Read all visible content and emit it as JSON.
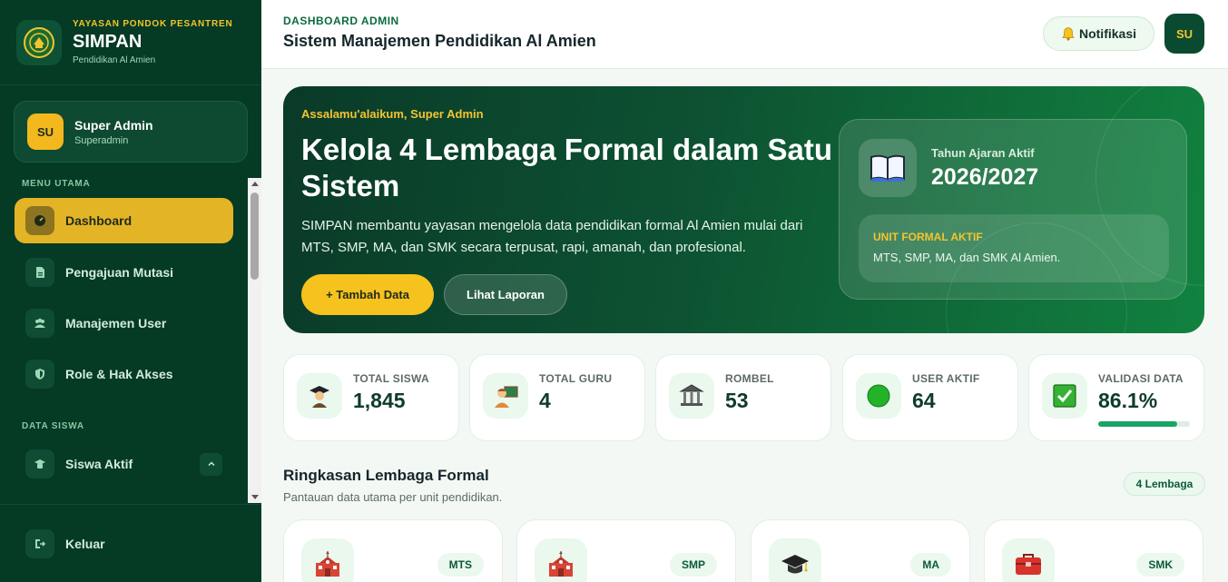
{
  "brand": {
    "foundation": "YAYASAN PONDOK PESANTREN",
    "name": "SIMPAN",
    "subtitle": "Pendidikan Al Amien"
  },
  "user": {
    "initials": "SU",
    "name": "Super Admin",
    "role": "Superadmin"
  },
  "sidebar": {
    "section_main": "MENU UTAMA",
    "items": [
      {
        "label": "Dashboard",
        "icon": "gauge-icon",
        "active": true
      },
      {
        "label": "Pengajuan Mutasi",
        "icon": "document-icon",
        "active": false
      },
      {
        "label": "Manajemen User",
        "icon": "users-icon",
        "active": false
      },
      {
        "label": "Role & Hak Akses",
        "icon": "shield-icon",
        "active": false
      }
    ],
    "section_students": "DATA SISWA",
    "student_item": {
      "label": "Siswa Aktif",
      "icon": "student-icon",
      "expanded": true
    },
    "logout_label": "Keluar"
  },
  "header": {
    "kicker": "DASHBOARD ADMIN",
    "title": "Sistem Manajemen Pendidikan Al Amien",
    "notif_label": "Notifikasi",
    "avatar": "SU"
  },
  "hero": {
    "greeting": "Assalamu'alaikum, Super Admin",
    "title": "Kelola 4 Lembaga Formal dalam Satu Sistem",
    "description": "SIMPAN membantu yayasan mengelola data pendidikan formal Al Amien mulai dari MTS, SMP, MA, dan SMK secara terpusat, rapi, amanah, dan profesional.",
    "primary_button": "+ Tambah Data",
    "secondary_button": "Lihat Laporan",
    "year_label": "Tahun Ajaran Aktif",
    "year_value": "2026/2027",
    "unit_label": "UNIT FORMAL AKTIF",
    "unit_text": "MTS, SMP, MA, dan SMK Al Amien."
  },
  "stats": [
    {
      "label": "TOTAL SISWA",
      "value": "1,845",
      "icon": "student-icon"
    },
    {
      "label": "TOTAL GURU",
      "value": "4",
      "icon": "teacher-icon"
    },
    {
      "label": "ROMBEL",
      "value": "53",
      "icon": "building-icon"
    },
    {
      "label": "USER AKTIF",
      "value": "64",
      "icon": "green-circle-icon"
    },
    {
      "label": "VALIDASI DATA",
      "value": "86.1%",
      "icon": "check-icon",
      "progress": 0.861
    }
  ],
  "summary": {
    "title": "Ringkasan Lembaga Formal",
    "subtitle": "Pantauan data utama per unit pendidikan.",
    "badge": "4 Lembaga",
    "units": [
      {
        "code": "MTS",
        "icon": "school-icon"
      },
      {
        "code": "SMP",
        "icon": "school-icon"
      },
      {
        "code": "MA",
        "icon": "graduation-cap-icon"
      },
      {
        "code": "SMK",
        "icon": "toolbox-icon"
      }
    ]
  },
  "colors": {
    "sidebar_bg": "#053a25",
    "accent_yellow": "#f6c21d",
    "brand_green": "#0b6b3d"
  }
}
